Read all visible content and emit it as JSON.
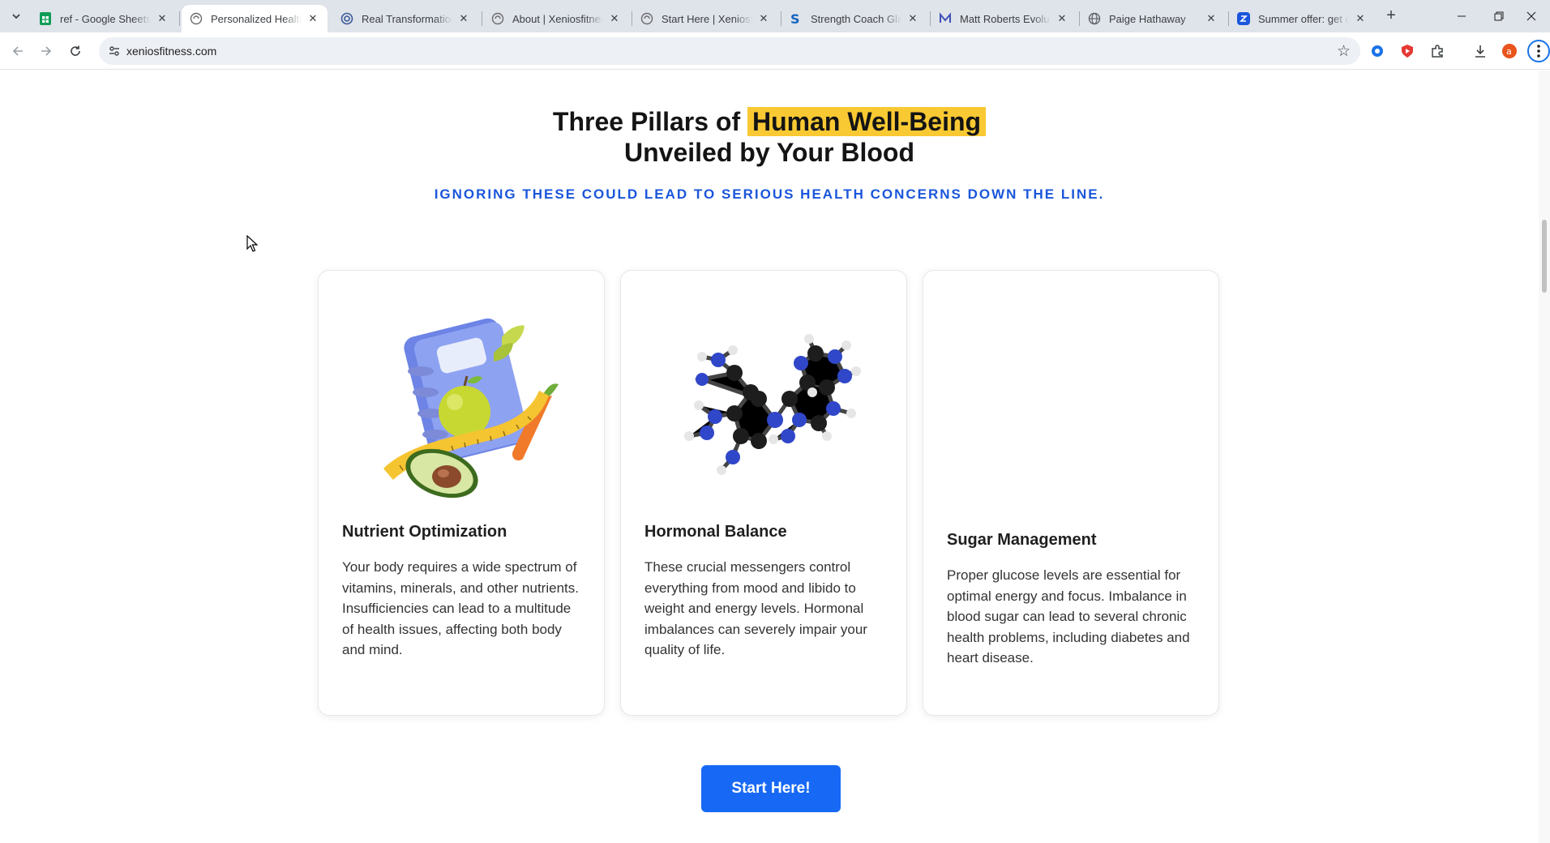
{
  "browser": {
    "tabs": [
      {
        "title": "ref - Google Sheets",
        "icon": "sheets-icon",
        "active": false
      },
      {
        "title": "Personalized Health C",
        "icon": "site-icon",
        "active": true
      },
      {
        "title": "Real Transformations:",
        "icon": "site-icon",
        "active": false
      },
      {
        "title": "About | Xeniosfitness",
        "icon": "site-icon",
        "active": false
      },
      {
        "title": "Start Here | Xeniosfitn",
        "icon": "site-icon",
        "active": false
      },
      {
        "title": "Strength Coach Glasg",
        "icon": "s-logo-icon",
        "active": false
      },
      {
        "title": "Matt Roberts Evolutic",
        "icon": "m-logo-icon",
        "active": false
      },
      {
        "title": "Paige Hathaway",
        "icon": "globe-icon",
        "active": false
      },
      {
        "title": "Summer offer: get on",
        "icon": "blue-square-icon",
        "active": false
      }
    ],
    "url": "xeniosfitness.com"
  },
  "section": {
    "heading_part1": "Three Pillars of ",
    "heading_highlight": "Human Well-Being",
    "heading_line2": "Unveiled by Your Blood",
    "subheading": "IGNORING THESE COULD LEAD TO SERIOUS HEALTH CONCERNS DOWN THE LINE."
  },
  "cards": [
    {
      "title": "Nutrient Optimization",
      "text": "Your body requires a wide spectrum of vitamins, minerals, and other nutrients. Insufficiencies can lead to a multitude of health issues, affecting both body and mind.",
      "image": "nutrition-illustration"
    },
    {
      "title": "Hormonal Balance",
      "text": "These crucial messengers control everything from mood and libido to weight and energy levels. Hormonal imbalances can severely impair your quality of life.",
      "image": "molecule-illustration"
    },
    {
      "title": "Sugar Management",
      "text": "Proper glucose levels are essential for optimal energy and focus. Imbalance in blood sugar can lead to several chronic health problems, including diabetes and heart disease.",
      "image": ""
    }
  ],
  "cta": {
    "label": "Start Here!"
  },
  "colors": {
    "highlight": "#f9c933",
    "accent_blue": "#1a56db",
    "button": "#1769f5"
  }
}
